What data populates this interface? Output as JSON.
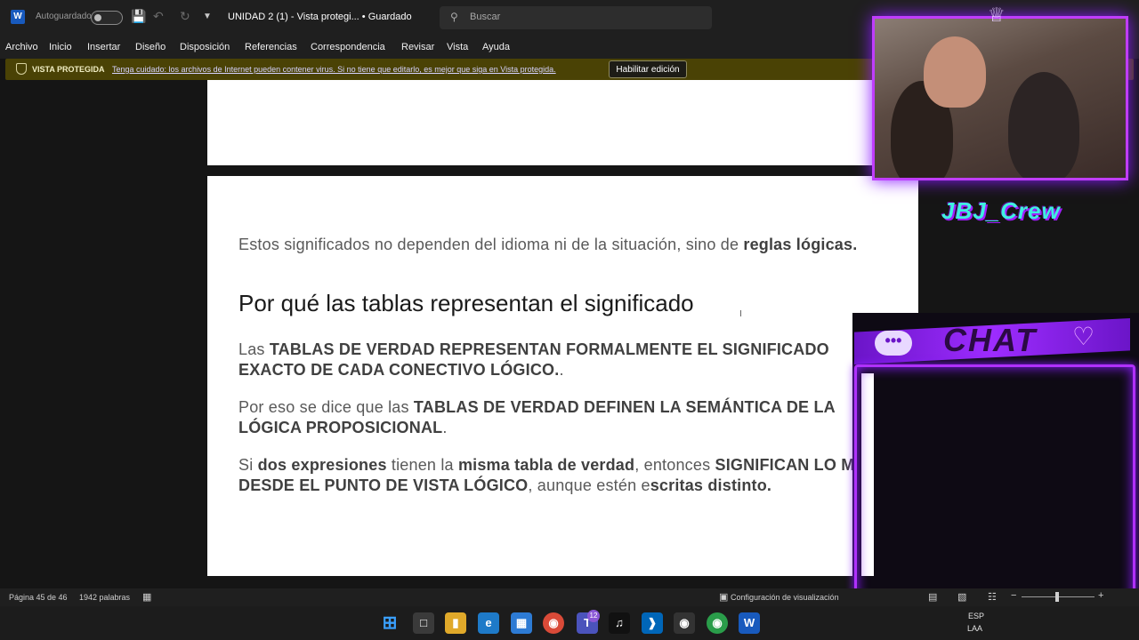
{
  "titlebar": {
    "autosave_label": "Autoguardado",
    "doc_title": "UNIDAD 2 (1) - Vista protegi... • Guardado",
    "search_placeholder": "Buscar"
  },
  "menu": [
    "Archivo",
    "Inicio",
    "Insertar",
    "Diseño",
    "Disposición",
    "Referencias",
    "Correspondencia",
    "Revisar",
    "Vista",
    "Ayuda"
  ],
  "protected_bar": {
    "title": "VISTA PROTEGIDA",
    "message": "Tenga cuidado: los archivos de Internet pueden contener virus. Si no tiene que editarlo, es mejor que siga en Vista protegida.",
    "button": "Habilitar edición"
  },
  "document": {
    "para1_normal": "Estos significados no dependen del idioma ni de la situación, sino de ",
    "para1_bold": "reglas lógicas.",
    "heading": "Por qué las tablas representan el significado",
    "para2_normal": "Las ",
    "para2_bold": "TABLAS DE VERDAD  REPRESENTAN FORMALMENTE EL SIGNIFICADO EXACTO DE CADA CONECTIVO LÓGICO.",
    "para2_end": ".",
    "para3_normal": "Por eso se dice que las ",
    "para3_bold": "TABLAS DE VERDAD DEFINEN LA SEMÁNTICA DE LA LÓGICA PROPOSICIONAL",
    "para3_end": ".",
    "para4_a": "Si ",
    "para4_b": "dos expresiones",
    "para4_c": " tienen la ",
    "para4_d": "misma tabla de verdad",
    "para4_e": ", entonces ",
    "para4_f": "SIGNIFICAN LO MISMO DESDE EL PUNTO DE VISTA LÓGICO",
    "para4_g": ", aunque estén e",
    "para4_h": "scritas distinto."
  },
  "overlay": {
    "crew_logo": "JBJ_Crew",
    "chat_title": "CHAT"
  },
  "statusbar": {
    "page": "Página 45 de 46",
    "words": "1942 palabras",
    "display_settings": "Configuración de visualización"
  },
  "tray": {
    "lang_top": "ESP",
    "lang_bottom": "LAA"
  },
  "taskbar": {
    "badge": "12"
  }
}
